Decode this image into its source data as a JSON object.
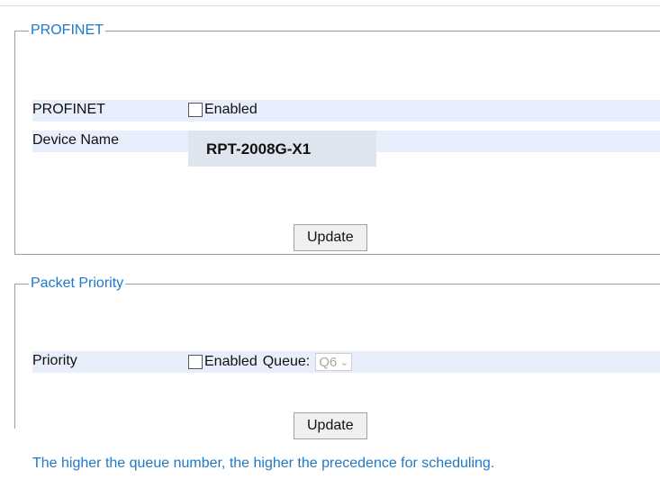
{
  "profinet_section": {
    "legend": "PROFINET",
    "profinet_row": {
      "label": "PROFINET",
      "checkbox_label": "Enabled",
      "checked": false
    },
    "device_row": {
      "label": "Device Name",
      "value": "RPT-2008G-X1"
    },
    "update_label": "Update"
  },
  "priority_section": {
    "legend": "Packet Priority",
    "priority_row": {
      "label": "Priority",
      "checkbox_label": "Enabled",
      "checked": false,
      "queue_label": "Queue:",
      "queue_value": "Q6"
    },
    "update_label": "Update"
  },
  "note": "The higher the queue number, the higher the precedence for scheduling."
}
